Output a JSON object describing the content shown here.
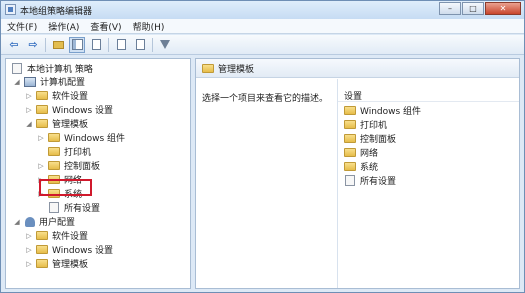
{
  "window": {
    "title": "本地组策略编辑器",
    "controls": [
      "–",
      "□",
      "✕"
    ]
  },
  "menu": [
    "文件(F)",
    "操作(A)",
    "查看(V)",
    "帮助(H)"
  ],
  "toolbar": {
    "back": "⇦",
    "forward": "⇨"
  },
  "tree": {
    "root": "本地计算机 策略",
    "computer_config": "计算机配置",
    "software_settings": "软件设置",
    "windows_settings": "Windows 设置",
    "admin_templates": "管理模板",
    "windows_components": "Windows 组件",
    "printers": "打印机",
    "control_panel": "控制面板",
    "network": "网络",
    "system": "系统",
    "all_settings": "所有设置",
    "user_config": "用户配置",
    "user_software_settings": "软件设置",
    "user_windows_settings": "Windows 设置",
    "user_admin_templates": "管理模板"
  },
  "right_pane": {
    "header": "管理模板",
    "description": "选择一个项目来查看它的描述。",
    "column_header": "设置",
    "items": [
      "Windows 组件",
      "打印机",
      "控制面板",
      "网络",
      "系统",
      "所有设置"
    ]
  },
  "colors": {
    "highlight": "#d0192c",
    "folder": "#e6bd4a"
  }
}
